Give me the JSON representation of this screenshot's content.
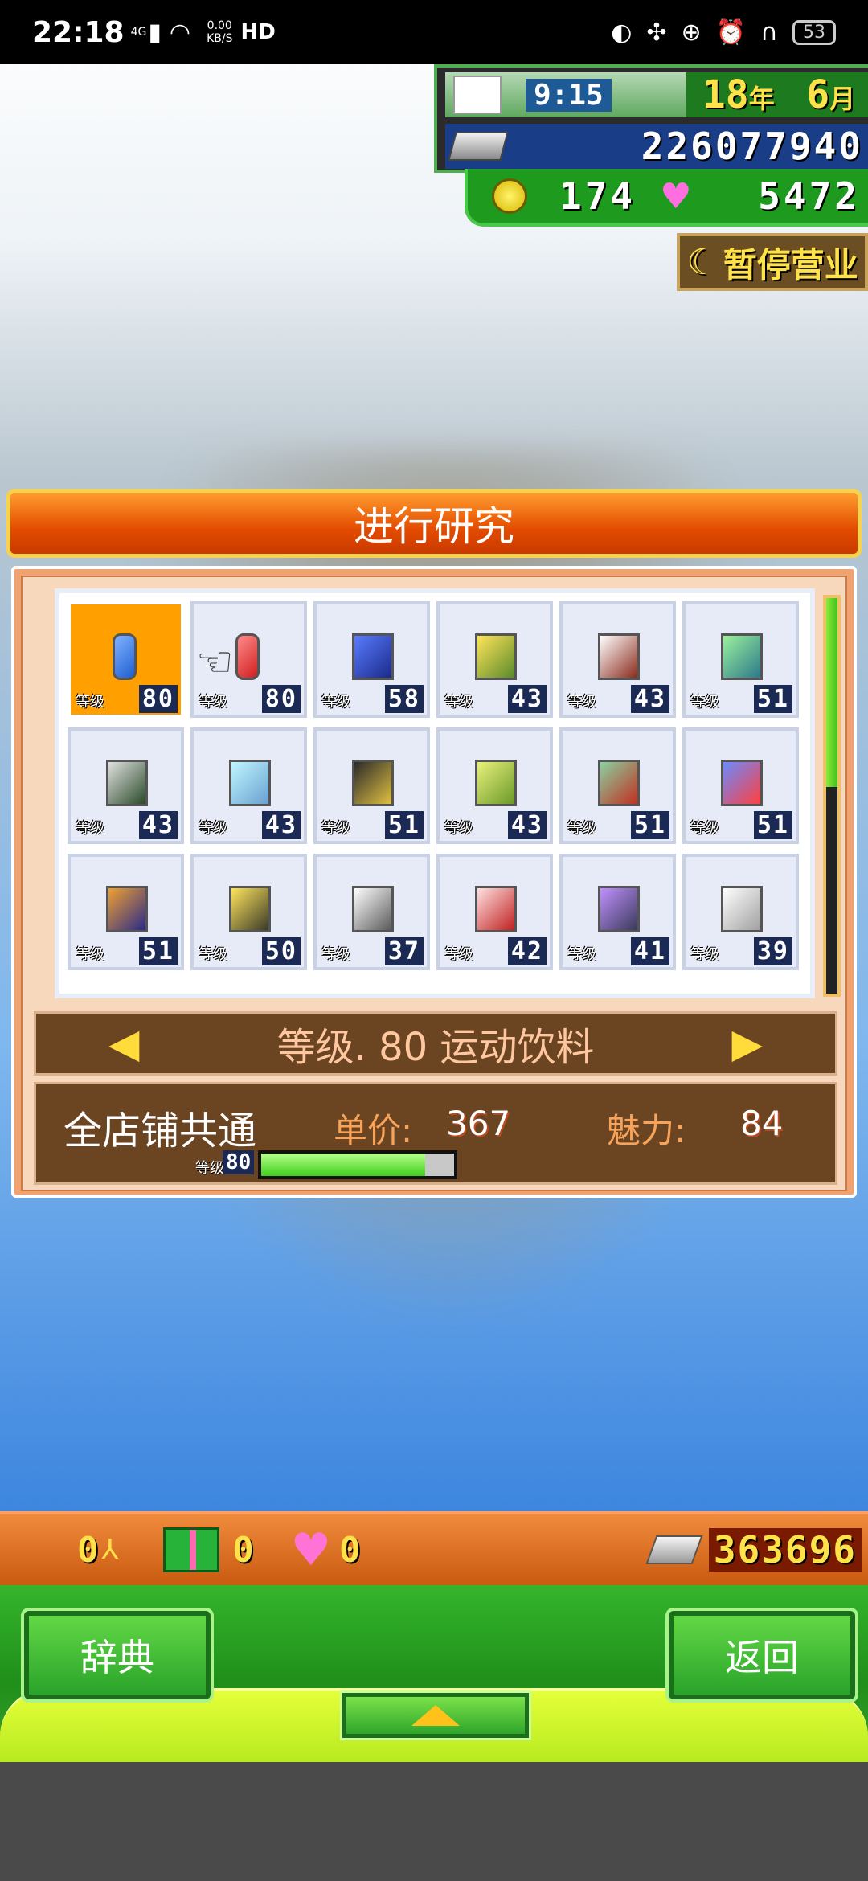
{
  "status_bar": {
    "time": "22:18",
    "signal": "4G",
    "speed_value": "0.00",
    "speed_unit": "KB/S",
    "hd": "HD",
    "battery": "53"
  },
  "hud": {
    "clock_time": "9:15",
    "year_num": "18",
    "year_unit": "年",
    "month_num": "6",
    "month_unit": "月",
    "money": "226077940",
    "coins": "174",
    "hearts": "5472",
    "pause_label": "暂停营业"
  },
  "panel": {
    "title": "进行研究",
    "items": [
      {
        "level_tag": "等级",
        "level": "80",
        "icon": "blue-drink-can-icon",
        "c1": "#7fb2ff",
        "c2": "#1f5fd0",
        "shape": "can"
      },
      {
        "level_tag": "等级",
        "level": "80",
        "icon": "red-drink-can-icon",
        "c1": "#ff8a8a",
        "c2": "#d01f1f",
        "shape": "can"
      },
      {
        "level_tag": "等级",
        "level": "58",
        "icon": "blue-console-icon",
        "c1": "#5a7bff",
        "c2": "#1a2a8a",
        "shape": "box"
      },
      {
        "level_tag": "等级",
        "level": "43",
        "icon": "game-card-icon",
        "c1": "#ffe45a",
        "c2": "#5a8a2a",
        "shape": "box"
      },
      {
        "level_tag": "等级",
        "level": "43",
        "icon": "character-card-icon",
        "c1": "#ffffff",
        "c2": "#8a2a1a",
        "shape": "box"
      },
      {
        "level_tag": "等级",
        "level": "51",
        "icon": "green-card-icon",
        "c1": "#9cf09c",
        "c2": "#2a7a8a",
        "shape": "box"
      },
      {
        "level_tag": "等级",
        "level": "43",
        "icon": "dark-card-icon",
        "c1": "#e0e0e0",
        "c2": "#2a4a2a",
        "shape": "box"
      },
      {
        "level_tag": "等级",
        "level": "43",
        "icon": "cyan-card-icon",
        "c1": "#bff6ff",
        "c2": "#6aa0d0",
        "shape": "box"
      },
      {
        "level_tag": "等级",
        "level": "51",
        "icon": "black-card-icon",
        "c1": "#2a2a2a",
        "c2": "#e0c040",
        "shape": "box"
      },
      {
        "level_tag": "等级",
        "level": "43",
        "icon": "checker-card-icon",
        "c1": "#e9f07a",
        "c2": "#6a9a2a",
        "shape": "box"
      },
      {
        "level_tag": "等级",
        "level": "51",
        "icon": "red-hero-card-icon",
        "c1": "#8ad0a0",
        "c2": "#c03020",
        "shape": "box"
      },
      {
        "level_tag": "等级",
        "level": "51",
        "icon": "robot-card-icon",
        "c1": "#6a8aff",
        "c2": "#ff4040",
        "shape": "box"
      },
      {
        "level_tag": "等级",
        "level": "51",
        "icon": "tile-card-icon",
        "c1": "#f0a030",
        "c2": "#2a2a8a",
        "shape": "box"
      },
      {
        "level_tag": "等级",
        "level": "50",
        "icon": "yellow-card-icon",
        "c1": "#ffe45a",
        "c2": "#3a3a2a",
        "shape": "box"
      },
      {
        "level_tag": "等级",
        "level": "37",
        "icon": "monster-card-icon",
        "c1": "#ffffff",
        "c2": "#5a5a5a",
        "shape": "box"
      },
      {
        "level_tag": "等级",
        "level": "42",
        "icon": "red-handheld-icon",
        "c1": "#ffe0e0",
        "c2": "#c02020",
        "shape": "box"
      },
      {
        "level_tag": "等级",
        "level": "41",
        "icon": "purple-console-icon",
        "c1": "#c090ff",
        "c2": "#3a3a5a",
        "shape": "box"
      },
      {
        "level_tag": "等级",
        "level": "39",
        "icon": "white-console-icon",
        "c1": "#ffffff",
        "c2": "#a0a0a0",
        "shape": "box"
      }
    ],
    "selected_name": "等级. 80 运动饮料",
    "scope": "全店铺共通",
    "price_label": "单价:",
    "price_value": "367",
    "charm_label": "魅力:",
    "charm_value": "84",
    "small_level_tag": "等级",
    "small_level": "80",
    "progress": 0.85,
    "scroll_position": 0.0
  },
  "bottom": {
    "staff_count": "0",
    "gift_count": "0",
    "heart_count": "0",
    "money": "363696",
    "dict_label": "辞典",
    "back_label": "返回"
  }
}
